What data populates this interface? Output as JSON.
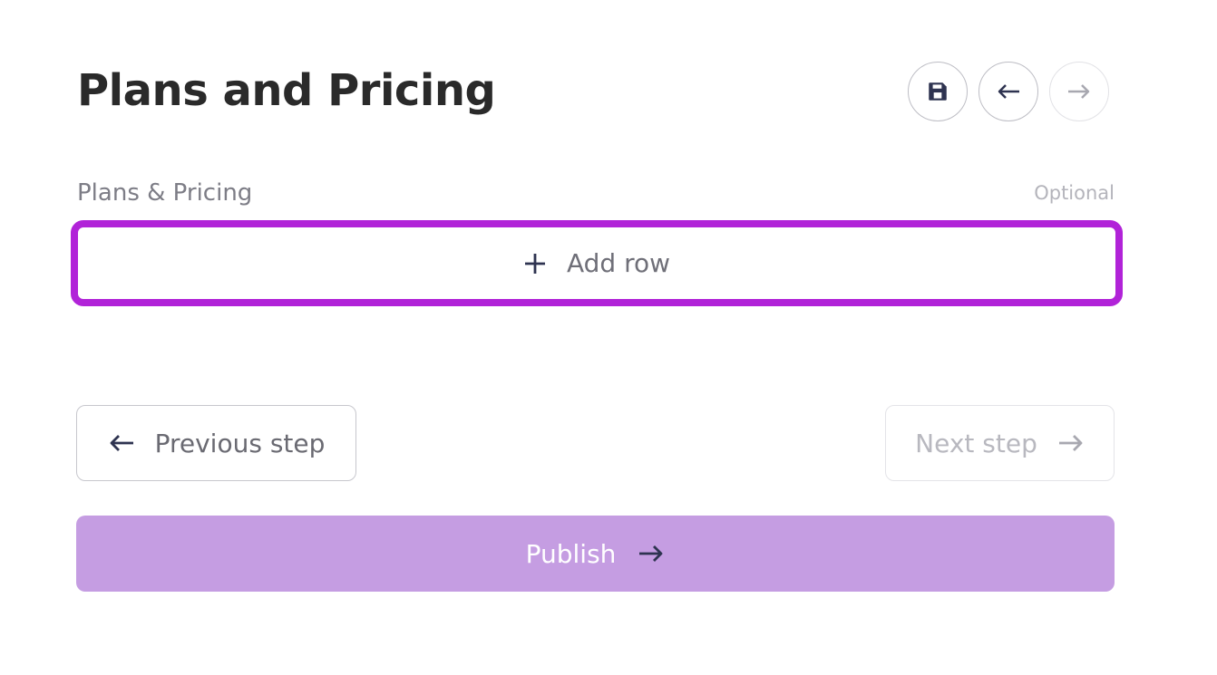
{
  "page": {
    "title": "Plans and Pricing"
  },
  "header_actions": {
    "save_icon": "save-icon",
    "back_icon": "arrow-left-icon",
    "forward_icon": "arrow-right-icon"
  },
  "section": {
    "label": "Plans & Pricing",
    "optional": "Optional"
  },
  "add_row": {
    "label": "Add row",
    "icon": "plus-icon",
    "highlight_color": "#b123d8"
  },
  "navigation": {
    "previous_label": "Previous step",
    "next_label": "Next step"
  },
  "publish": {
    "label": "Publish",
    "color": "#c59de2"
  }
}
